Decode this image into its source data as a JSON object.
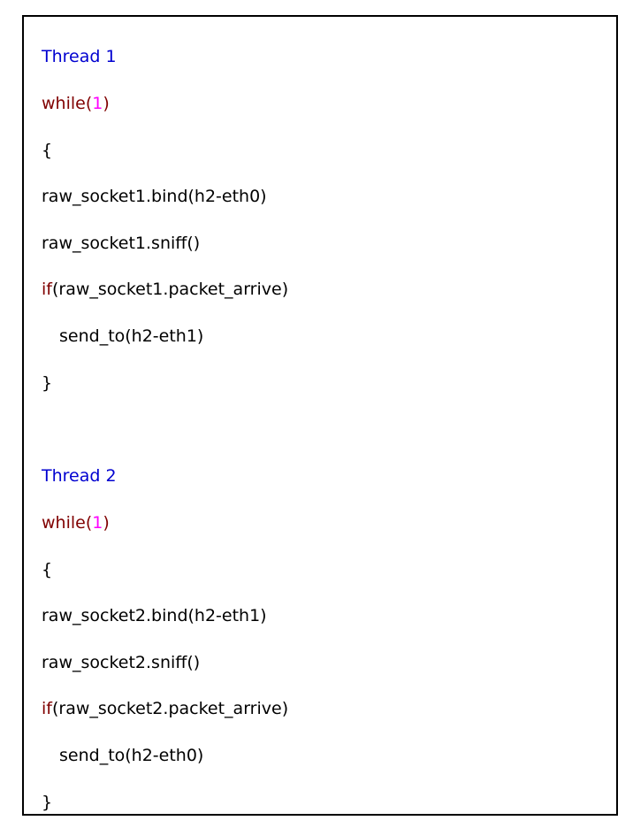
{
  "colors": {
    "title": "#0000d0",
    "keyword": "#800000",
    "number": "#ff00ff",
    "text": "#000000",
    "border": "#000000"
  },
  "thread1": {
    "title": "Thread 1",
    "while_kw": "while",
    "while_open": "(",
    "while_num": "1",
    "while_close": ")",
    "brace_open": "{",
    "bind_line": "raw_socket1.bind(h2-eth0)",
    "sniff_line": "raw_socket1.sniff()",
    "if_kw": "if",
    "if_cond": "(raw_socket1.packet_arrive)",
    "send_line": "send_to(h2-eth1)",
    "brace_close": "}"
  },
  "thread2": {
    "title": "Thread 2",
    "while_kw": "while",
    "while_open": "(",
    "while_num": "1",
    "while_close": ")",
    "brace_open": "{",
    "bind_line": "raw_socket2.bind(h2-eth1)",
    "sniff_line": "raw_socket2.sniff()",
    "if_kw": "if",
    "if_cond": "(raw_socket2.packet_arrive)",
    "send_line": "send_to(h2-eth0)",
    "brace_close": "}"
  }
}
